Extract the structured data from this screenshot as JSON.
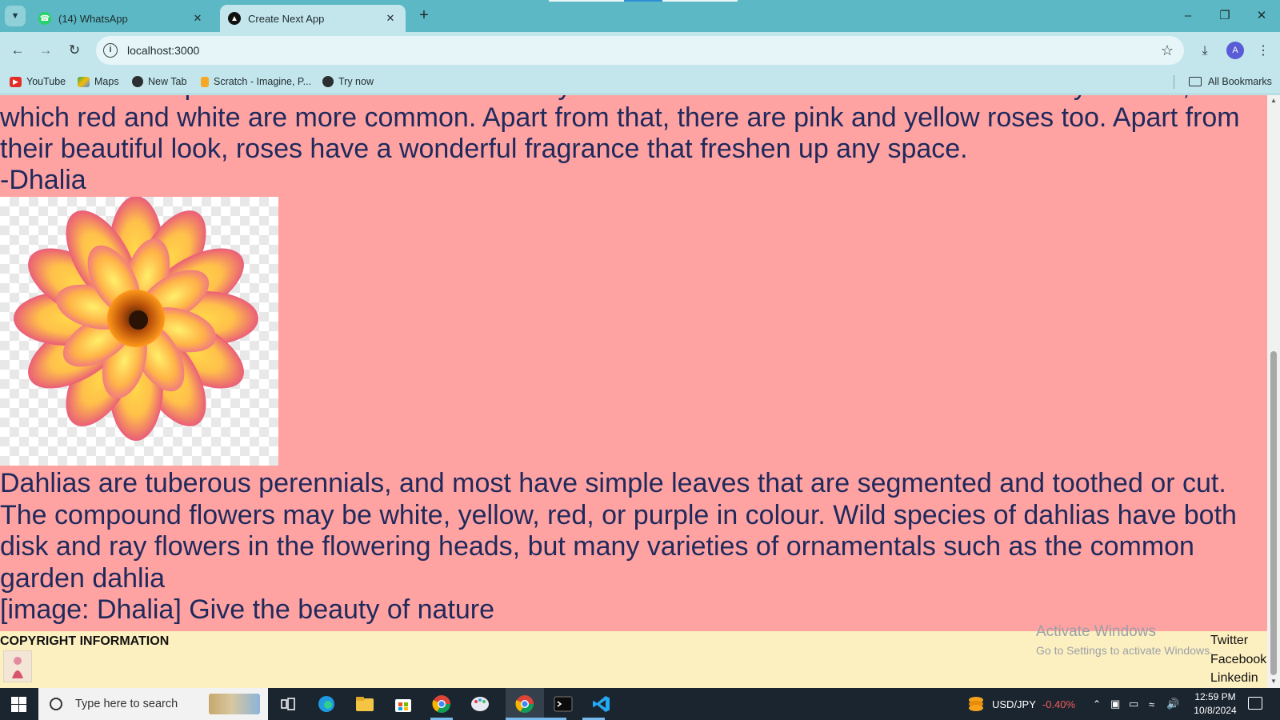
{
  "browser": {
    "tabs": [
      {
        "title": "(14) WhatsApp",
        "icon": "whatsapp-icon",
        "active": false
      },
      {
        "title": "Create Next App",
        "icon": "nextjs-icon",
        "active": true
      }
    ],
    "url": "localhost:3000",
    "profile_initial": "A",
    "bookmarks": [
      {
        "label": "YouTube",
        "icon": "youtube-icon"
      },
      {
        "label": "Maps",
        "icon": "maps-icon"
      },
      {
        "label": "New Tab",
        "icon": "globe-icon"
      },
      {
        "label": "Scratch - Imagine, P...",
        "icon": "scratch-icon"
      },
      {
        "label": "Try now",
        "icon": "globe-icon"
      }
    ],
    "all_bookmarks": "All Bookmarks"
  },
  "page": {
    "para_top": "It has beautiful petals and a stem that is usually full of thorns. Roses can be found in many colours, our of which red and white are more common. Apart from that, there are pink and yellow roses too. Apart from their beautiful look, roses have a wonderful fragrance that freshen up any space.",
    "flower_title": "-Dhalia",
    "dahlia_text": "Dahlias are tuberous perennials, and most have simple leaves that are segmented and toothed or cut. The compound flowers may be white, yellow, red, or purple in colour. Wild species of dahlias have both disk and ray flowers in the flowering heads, but many varieties of ornamentals such as the common garden dahlia",
    "caption": "[image: Dhalia] Give the beauty of nature",
    "background_color": "#ffa2a2",
    "text_color": "#1f2a5c"
  },
  "footer": {
    "copyright": "COPYRIGHT INFORMATION",
    "links": [
      "Twitter",
      "Facebook",
      "Linkedin"
    ],
    "background_color": "#fdf0c0"
  },
  "watermark": {
    "line1": "Activate Windows",
    "line2": "Go to Settings to activate Windows."
  },
  "taskbar": {
    "search_placeholder": "Type here to search",
    "ticker_label": "USD/JPY",
    "ticker_change": "-0.40%",
    "time": "12:59 PM",
    "date": "10/8/2024"
  }
}
